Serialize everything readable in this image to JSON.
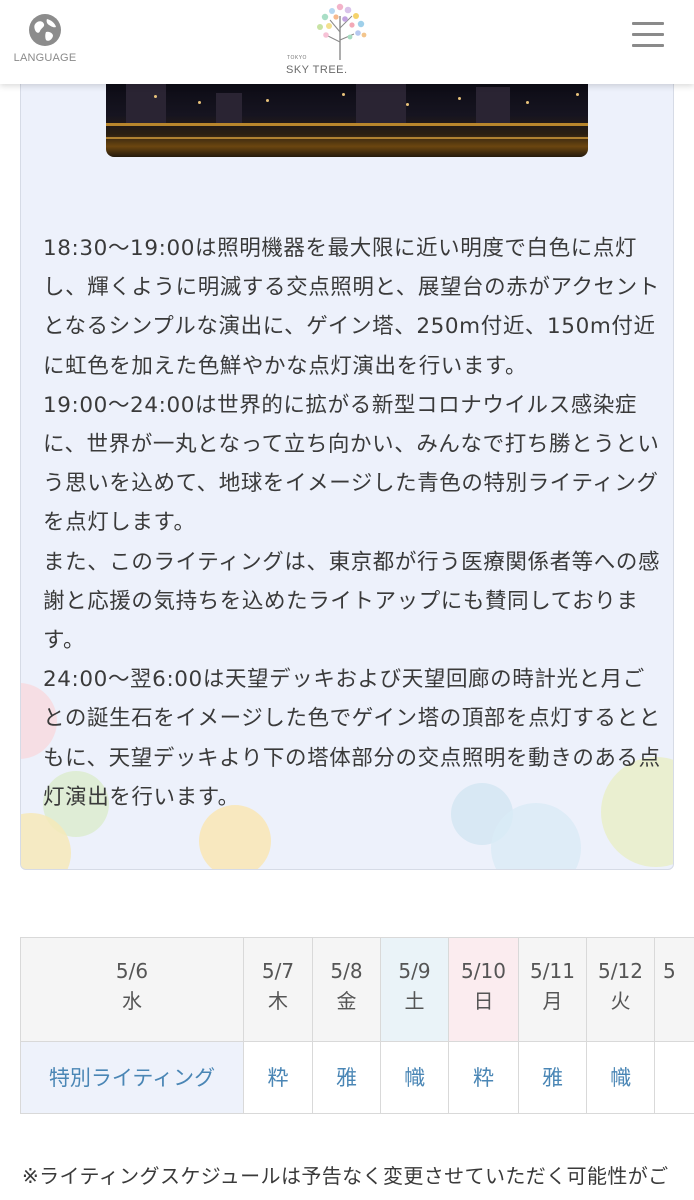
{
  "header": {
    "language_label": "LANGUAGE",
    "logo_small": "TOKYO",
    "logo_text": "SKY TREE",
    "logo_mark": "."
  },
  "description": {
    "paragraphs": [
      "18:30〜19:00は照明機器を最大限に近い明度で白色に点灯し、輝くように明滅する交点照明と、展望台の赤がアクセントとなるシンプルな演出に、ゲイン塔、250m付近、150m付近に虹色を加えた色鮮やかな点灯演出を行います。",
      "19:00〜24:00は世界的に拡がる新型コロナウイルス感染症に、世界が一丸となって立ち向かい、みんなで打ち勝とうという思いを込めて、地球をイメージした青色の特別ライティングを点灯します。",
      "また、このライティングは、東京都が行う医療関係者等への感謝と応援の気持ちを込めたライトアップにも賛同しております。",
      "24:00〜翌6:00は天望デッキおよび天望回廊の時計光と月ごとの誕生石をイメージした色でゲイン塔の頂部を点灯するとともに、天望デッキより下の塔体部分の交点照明を動きのある点灯演出を行います。"
    ]
  },
  "schedule": {
    "row_label": "特別ライティング",
    "days": [
      {
        "date": "5/6",
        "weekday": "水",
        "lighting": "",
        "kind": "weekday"
      },
      {
        "date": "5/7",
        "weekday": "木",
        "lighting": "粋",
        "kind": "weekday"
      },
      {
        "date": "5/8",
        "weekday": "金",
        "lighting": "雅",
        "kind": "weekday"
      },
      {
        "date": "5/9",
        "weekday": "土",
        "lighting": "幟",
        "kind": "saturday"
      },
      {
        "date": "5/10",
        "weekday": "日",
        "lighting": "粋",
        "kind": "sunday"
      },
      {
        "date": "5/11",
        "weekday": "月",
        "lighting": "雅",
        "kind": "weekday"
      },
      {
        "date": "5/12",
        "weekday": "火",
        "lighting": "幟",
        "kind": "weekday"
      },
      {
        "date": "5",
        "weekday": "",
        "lighting": "",
        "kind": "weekday"
      }
    ],
    "colors": {
      "saturday": "#eaf3f8",
      "sunday": "#fbecef",
      "weekday": "#f5f5f5",
      "link": "#4a86b5"
    }
  },
  "footnote": "※ライティングスケジュールは予告なく変更させていただく可能性がご"
}
